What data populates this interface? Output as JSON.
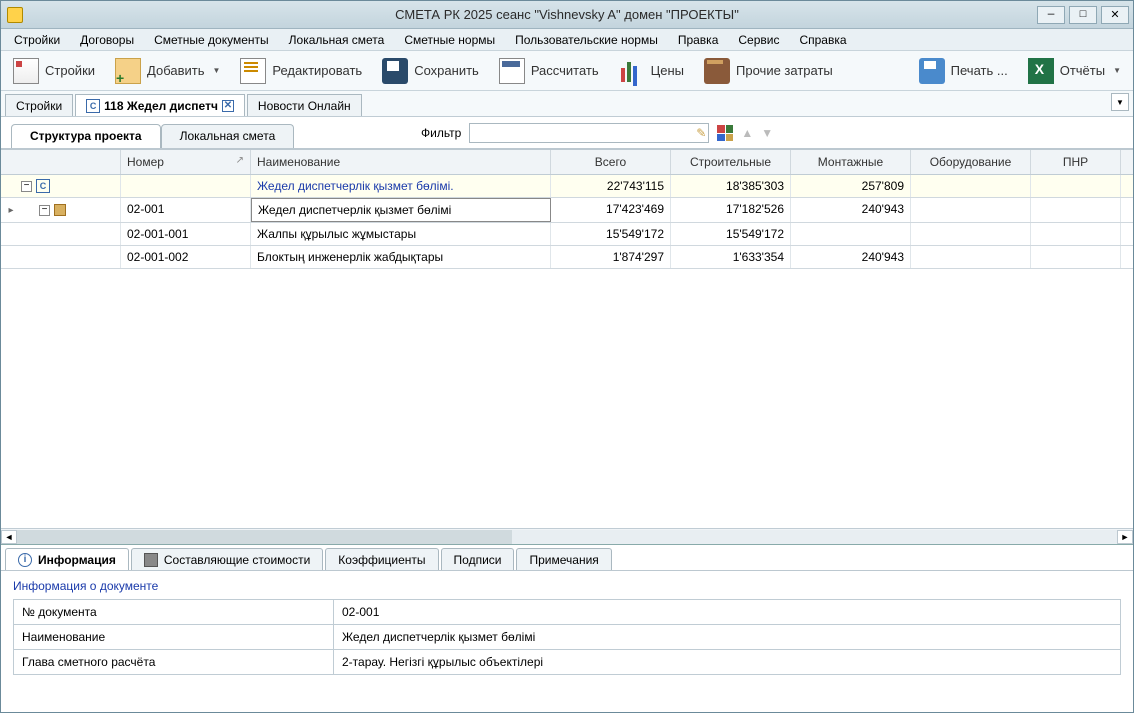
{
  "titlebar": {
    "text": "СМЕТА РК 2025     сеанс \"Vishnevsky A\"  домен \"ПРОЕКТЫ\""
  },
  "menu": [
    "Стройки",
    "Договоры",
    "Сметные документы",
    "Локальная смета",
    "Сметные нормы",
    "Пользовательские нормы",
    "Правка",
    "Сервис",
    "Справка"
  ],
  "toolbar": {
    "stroiki": "Стройки",
    "add": "Добавить",
    "edit": "Редактировать",
    "save": "Сохранить",
    "calc": "Рассчитать",
    "prices": "Цены",
    "other": "Прочие затраты",
    "print": "Печать ...",
    "reports": "Отчёты"
  },
  "doctabs": {
    "t1": "Стройки",
    "t2": "118 Жедел диспетч",
    "t3": "Новости Онлайн"
  },
  "section_tabs": {
    "t1": "Структура проекта",
    "t2": "Локальная смета"
  },
  "filter_label": "Фильтр",
  "grid": {
    "headers": {
      "number": "Номер",
      "name": "Наименование",
      "total": "Всего",
      "constr": "Строительные",
      "mount": "Монтажные",
      "equip": "Оборудование",
      "pnr": "ПНР"
    },
    "rows": [
      {
        "type": "project",
        "number": "",
        "name": "Жедел диспетчерлік қызмет бөлімі.",
        "total": "22'743'115",
        "constr": "18'385'303",
        "mount": "257'809",
        "equip": "",
        "pnr": ""
      },
      {
        "type": "section",
        "number": "02-001",
        "name": "Жедел диспетчерлік қызмет бөлімі",
        "total": "17'423'469",
        "constr": "17'182'526",
        "mount": "240'943",
        "equip": "",
        "pnr": ""
      },
      {
        "type": "item",
        "number": "02-001-001",
        "name": "Жалпы құрылыс жұмыстары",
        "total": "15'549'172",
        "constr": "15'549'172",
        "mount": "",
        "equip": "",
        "pnr": ""
      },
      {
        "type": "item",
        "number": "02-001-002",
        "name": "Блоктың инженерлік жабдықтары",
        "total": "1'874'297",
        "constr": "1'633'354",
        "mount": "240'943",
        "equip": "",
        "pnr": ""
      }
    ]
  },
  "bottom_tabs": {
    "info": "Информация",
    "components": "Составляющие стоимости",
    "coeff": "Коэффициенты",
    "sign": "Подписи",
    "notes": "Примечания"
  },
  "info": {
    "title": "Информация о документе",
    "doc_no_label": "№ документа",
    "doc_no_value": "02-001",
    "name_label": "Наименование",
    "name_value": "Жедел диспетчерлік қызмет бөлімі",
    "chapter_label": "Глава сметного расчёта",
    "chapter_value": "2-тарау. Негізгі құрылыс объектілері"
  }
}
